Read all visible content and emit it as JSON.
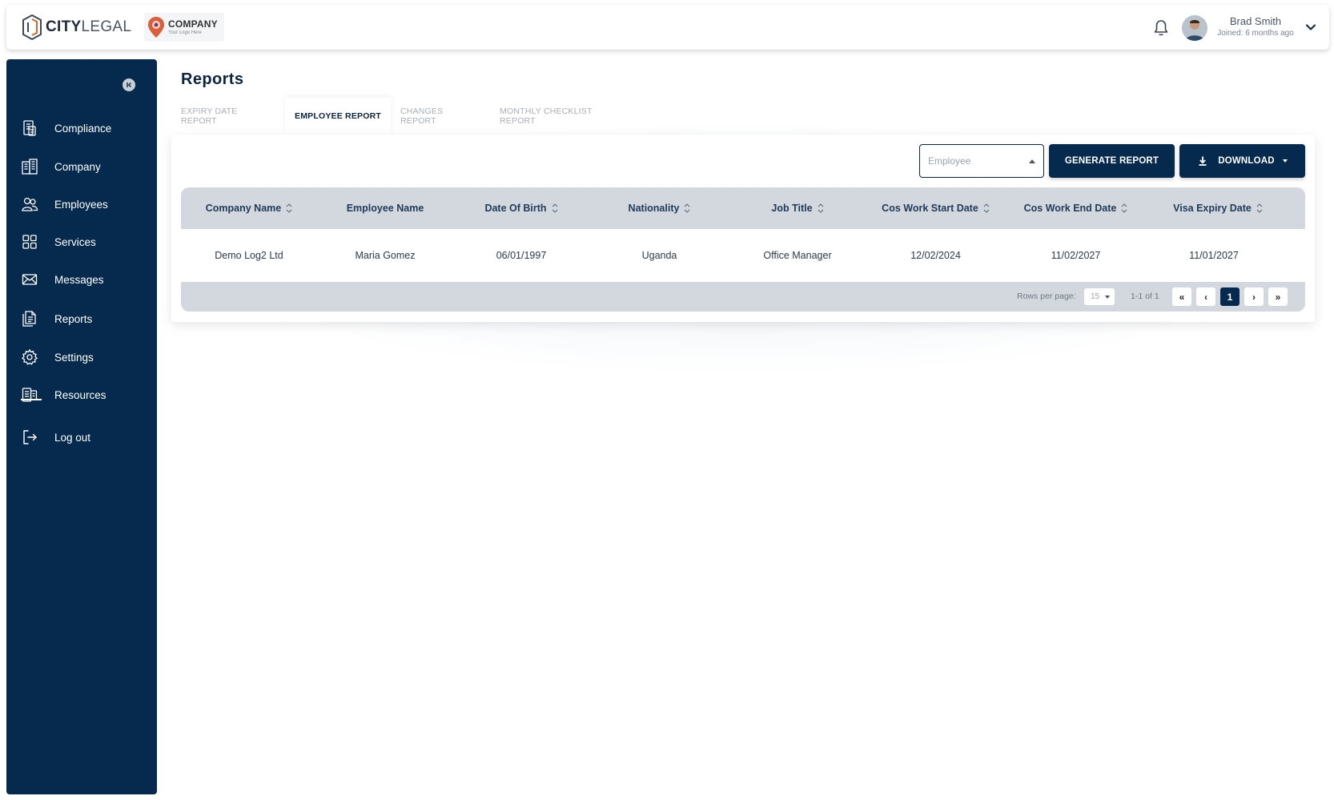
{
  "brand": {
    "name_bold": "CITY",
    "name_light": "LEGAL",
    "company_title": "COMPANY",
    "company_sub": "Your Logo Here"
  },
  "header": {
    "user_name": "Brad Smith",
    "user_joined": "Joined: 6 months ago"
  },
  "sidebar": {
    "items": [
      {
        "label": "Compliance",
        "icon": "compliance-icon"
      },
      {
        "label": "Company",
        "icon": "building-icon"
      },
      {
        "label": "Employees",
        "icon": "users-icon"
      },
      {
        "label": "Services",
        "icon": "grid-icon"
      },
      {
        "label": "Messages",
        "icon": "envelope-icon"
      },
      {
        "label": "Reports",
        "icon": "reports-icon"
      },
      {
        "label": "Settings",
        "icon": "gear-icon"
      },
      {
        "label": "Resources",
        "icon": "resources-icon"
      },
      {
        "label": "Log out",
        "icon": "logout-icon"
      }
    ],
    "active": "Reports"
  },
  "page": {
    "title": "Reports",
    "tabs": [
      {
        "label": "EXPIRY DATE REPORT"
      },
      {
        "label": "EMPLOYEE REPORT"
      },
      {
        "label": "CHANGES REPORT"
      },
      {
        "label": "MONTHLY CHECKLIST REPORT"
      }
    ],
    "active_tab": "EMPLOYEE REPORT"
  },
  "toolbar": {
    "select_placeholder": "Employee",
    "generate_label": "GENERATE REPORT",
    "download_label": "DOWNLOAD"
  },
  "table": {
    "columns": [
      "Company Name",
      "Employee Name",
      "Date Of Birth",
      "Nationality",
      "Job Title",
      "Cos Work Start Date",
      "Cos Work End Date",
      "Visa Expiry Date"
    ],
    "rows": [
      [
        "Demo Log2 Ltd",
        "Maria Gomez",
        "06/01/1997",
        "Uganda",
        "Office Manager",
        "12/02/2024",
        "11/02/2027",
        "11/01/2027"
      ]
    ]
  },
  "pagination": {
    "rows_per_page_label": "Rows per page:",
    "rows_per_page": "15",
    "range": "1-1 of 1",
    "first": "«",
    "prev": "‹",
    "current": "1",
    "next": "›",
    "last": "»"
  },
  "colors": {
    "navy": "#062a4e",
    "table_header": "#d3d8de"
  }
}
